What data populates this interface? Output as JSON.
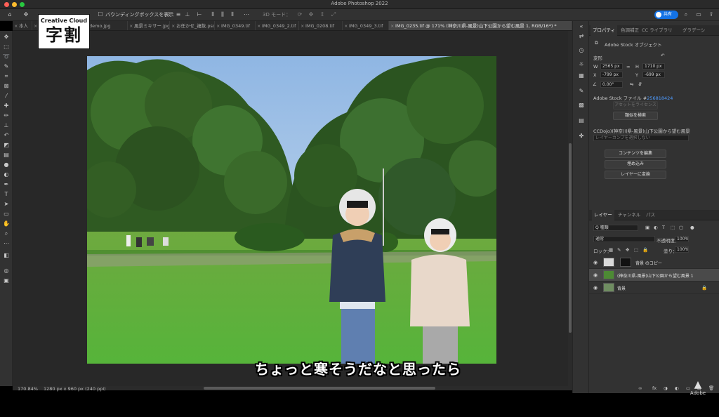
{
  "app": {
    "title": "Adobe Photoshop 2022"
  },
  "colors": {
    "accent": "#1473e6",
    "link": "#4e9bff"
  },
  "options_bar": {
    "show_bounding_box": "バウンディングボックスを表示",
    "mode_3d": "3D モード：",
    "share_label": "共有"
  },
  "logo": {
    "top": "Creative Cloud",
    "main": "字割"
  },
  "tabs": [
    {
      "label": "本人"
    },
    {
      "label": "曲ケ"
    },
    {
      "label": "demo.jpg"
    },
    {
      "label": "風景ミキサー.jpg"
    },
    {
      "label": "お任かせ_複数.psd"
    },
    {
      "label": "IMG_0349.tif"
    },
    {
      "label": "IMG_0349_2.tif"
    },
    {
      "label": "IMG_0208.tif"
    },
    {
      "label": "IMG_0349_3.tif"
    },
    {
      "label": "IMG_0235.tif @ 171% (神奈川県-風景)山下公園から望む風景 1, RGB/16*) *",
      "active": true
    }
  ],
  "status": {
    "zoom": "170.84%",
    "doc_size": "1280 px x 960 px (240 ppi)"
  },
  "subtitle": "ちょっと寒そうだなと思ったら",
  "properties": {
    "tabs": [
      "プロパティ",
      "色調補正",
      "CC ライブラリ",
      "グラデーシ"
    ],
    "object_type": "Adobe Stock オブジェクト",
    "transform_label": "変形",
    "w_label": "W",
    "w_value": "2565 px",
    "h_label": "H",
    "h_value": "1710 px",
    "x_label": "X",
    "x_value": "-799 px",
    "y_label": "Y",
    "y_value": "-699 px",
    "angle_value": "0.00°",
    "stock_file_label": "Adobe Stock ファイル #",
    "stock_file_id": "256818424",
    "license_btn": "アセットをライセンス",
    "similar_btn": "類似を検索",
    "library_name": "CCDojo)(神奈川県-風景)山下公園から望む風景",
    "layer_comp_placeholder": "レイヤーカンプを選択しない",
    "edit_contents_btn": "コンテンツを編集",
    "embed_btn": "埋め込み",
    "convert_btn": "レイヤーに変換"
  },
  "layers_panel": {
    "tabs": [
      "レイヤー",
      "チャンネル",
      "パス"
    ],
    "filter_kind": "Q 種類",
    "blend_mode": "通常",
    "opacity_label": "不透明度：",
    "opacity_value": "100%",
    "lock_label": "ロック：",
    "fill_label": "塗り：",
    "fill_value": "100%",
    "layers": [
      {
        "name": "背景 のコピー",
        "selected": false
      },
      {
        "name": "(神奈川県-風景)山下公園から望む風景 1",
        "selected": true
      },
      {
        "name": "背景",
        "selected": false
      }
    ]
  },
  "watermark": {
    "label": "Adobe"
  }
}
